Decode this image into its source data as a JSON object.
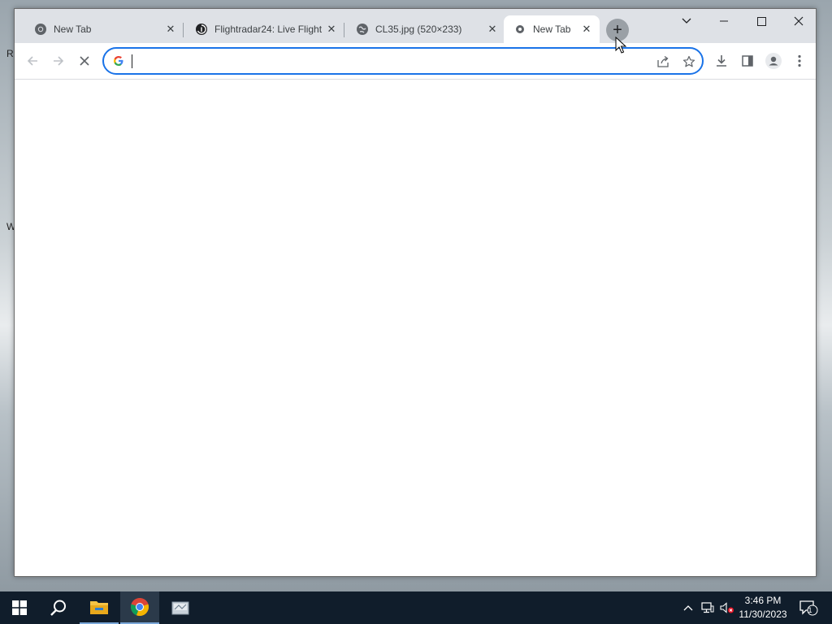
{
  "desktop": {
    "glyph_r": "R",
    "glyph_w": "W"
  },
  "browser": {
    "tabs": [
      {
        "title": "New Tab",
        "favicon": "chrome-icon",
        "active": false
      },
      {
        "title": "Flightradar24: Live Flight",
        "favicon": "flightradar24-icon",
        "active": false
      },
      {
        "title": "CL35.jpg (520×233)",
        "favicon": "globe-icon",
        "active": false
      },
      {
        "title": "New Tab",
        "favicon": "loading-icon",
        "active": true
      }
    ],
    "new_tab_symbol": "+",
    "omnibox": {
      "value": "",
      "placeholder": ""
    },
    "accent_color": "#1a73e8"
  },
  "taskbar": {
    "apps": [
      "start-icon",
      "search-icon",
      "file-explorer-icon",
      "chrome-icon",
      "app-icon"
    ],
    "clock_time": "3:46 PM",
    "clock_date": "11/30/2023",
    "notification_count": "1"
  }
}
